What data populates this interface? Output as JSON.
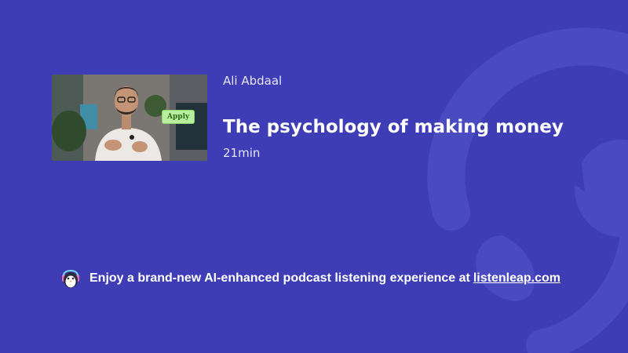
{
  "episode": {
    "author": "Ali Abdaal",
    "title": "The psychology of making money",
    "duration": "21min",
    "thumbnail_badge": "Apply"
  },
  "promo": {
    "text": "Enjoy a brand-new AI-enhanced podcast listening experience at",
    "link_text": "listenleap.com"
  },
  "colors": {
    "background": "#3e3db5",
    "watermark": "#4a4bc0",
    "badge_bg": "#b8ef9e"
  },
  "icons": {
    "watermark": "listenleap-logo-watermark",
    "mascot": "penguin-headphones-icon"
  }
}
